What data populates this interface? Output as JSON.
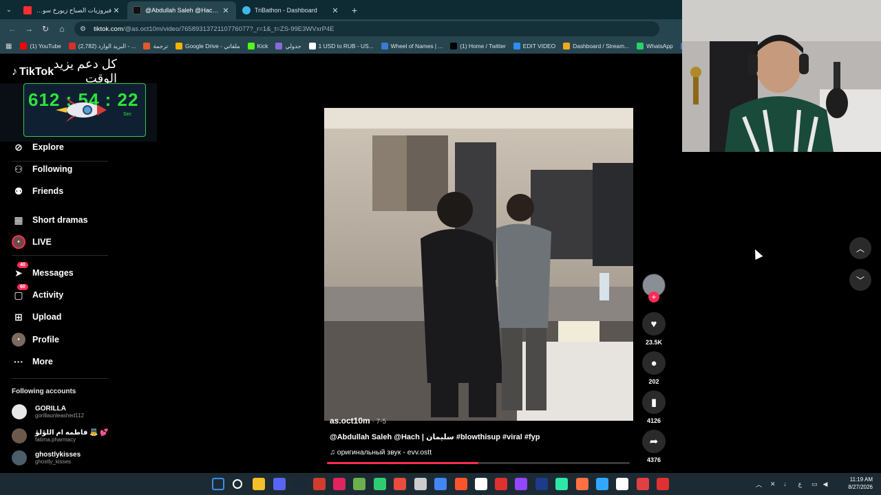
{
  "browser": {
    "tabs": [
      {
        "label": "فيروزيات الصباح زيورخ سويسرا...",
        "favicon_color": "#ff2d2d",
        "active": false
      },
      {
        "label": "@Abdullah Saleh @Hach | سليمان",
        "favicon_color": "#111111",
        "active": true
      },
      {
        "label": "TriBathon - Dashboard",
        "favicon_color": "#3fb8e8",
        "active": false
      }
    ],
    "url_host": "tiktok.com",
    "url_path": "/@as.oct10m/video/7658931372110776077?_r=1&_t=ZS-99E3WVxrP4E",
    "bookmarks": [
      {
        "label": "(1) YouTube",
        "color": "#ff0000"
      },
      {
        "label": "(2,782) البريد الوارد - ...",
        "color": "#d93025"
      },
      {
        "label": "ترجمة",
        "color": "#e05a2b"
      },
      {
        "label": "Google Drive - ملفاتي",
        "color": "#f4b400"
      },
      {
        "label": "Kick",
        "color": "#53fc18"
      },
      {
        "label": "جدولي",
        "color": "#8a6bd6"
      },
      {
        "label": "1 USD to RUB - US...",
        "color": "#ffffff"
      },
      {
        "label": "Wheel of Names | ...",
        "color": "#3a7bd5"
      },
      {
        "label": "(1) Home / Twitter",
        "color": "#000000"
      },
      {
        "label": "EDIT VIDEO",
        "color": "#2d8cff"
      },
      {
        "label": "Dashboard / Stream...",
        "color": "#f5a623"
      },
      {
        "label": "WhatsApp",
        "color": "#25d366"
      },
      {
        "label": "D",
        "color": "#5c6bc0"
      }
    ]
  },
  "overlay": {
    "arabic_text": "كل دعم يزيد الوقت",
    "timer_digits": "612 : 54 : 22",
    "timer_unit": "Sec",
    "logo_text": "TikTok"
  },
  "sidebar": {
    "nav": [
      {
        "label": "Explore",
        "icon": "compass-icon",
        "glyph": "⊘"
      },
      {
        "label": "Following",
        "icon": "user-follow-icon",
        "glyph": "⚇"
      },
      {
        "label": "Friends",
        "icon": "friends-icon",
        "glyph": "⚉"
      },
      {
        "label": "Short dramas",
        "icon": "film-icon",
        "glyph": "▦"
      },
      {
        "label": "LIVE",
        "icon": "live-avatar-icon",
        "glyph": "●"
      },
      {
        "label": "Messages",
        "icon": "paper-plane-icon",
        "glyph": "➤",
        "badge": "40"
      },
      {
        "label": "Activity",
        "icon": "activity-icon",
        "glyph": "▢",
        "badge": "60"
      },
      {
        "label": "Upload",
        "icon": "upload-plus-icon",
        "glyph": "⊞"
      },
      {
        "label": "Profile",
        "icon": "profile-avatar-icon",
        "glyph": "●"
      },
      {
        "label": "More",
        "icon": "more-dots-icon",
        "glyph": "···"
      }
    ],
    "following_title": "Following accounts",
    "following": [
      {
        "name": "GORILLA",
        "handle": "gorillaunleashed112",
        "color": "#e8e8e8"
      },
      {
        "name": "فاطمه ام اللؤلؤ 👼 💕",
        "handle": "fatima.pharmacy",
        "color": "#6b5a4a"
      },
      {
        "name": "ghostlykisses",
        "handle": "ghostly_kisses",
        "color": "#4b5d6b"
      }
    ]
  },
  "video": {
    "author": "as.oct10m",
    "date": " · 7-5",
    "caption": "@Abdullah Saleh  @Hach | سليمان #blowthisup #viral #fyp",
    "sound": "♫   оригинальный звук - evv.ostt",
    "progress": 0.5
  },
  "actions": {
    "likes": "23.5K",
    "comments": "202",
    "saves": "4126",
    "shares": "4376"
  },
  "taskbar": {
    "time": "11:19 AM",
    "date": "8/27/2026",
    "lang": "ع",
    "apps": [
      "#3a8ee6",
      "#ffffff",
      "#f3c02a",
      "#5865f2",
      "#1b2838",
      "#d33c2c",
      "#e0245e",
      "#6ab04c",
      "#2ecc71",
      "#e74c3c",
      "#cccccc",
      "#4285f4",
      "#fb542b",
      "#ffffff",
      "#e03030",
      "#9146ff",
      "#1e3a8a",
      "#2ee6a8",
      "#ff7043",
      "#31a8ff",
      "#ffffff",
      "#e04040",
      "#e03030"
    ]
  }
}
